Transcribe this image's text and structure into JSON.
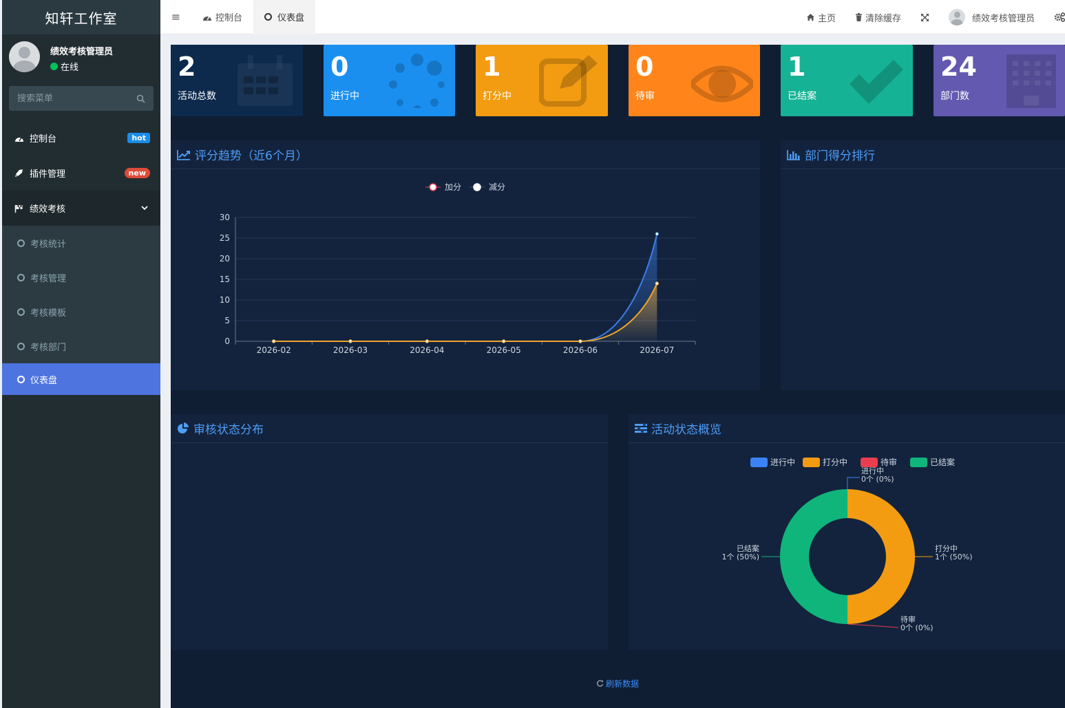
{
  "sidebar": {
    "logo": "知轩工作室",
    "user": {
      "name": "绩效考核管理员",
      "status": "在线"
    },
    "search_placeholder": "搜索菜单",
    "items": [
      {
        "label": "控制台",
        "badge": "hot",
        "icon": "dashboard-icon"
      },
      {
        "label": "插件管理",
        "badge": "new",
        "icon": "rocket-icon"
      },
      {
        "label": "绩效考核",
        "icon": "flag-icon"
      }
    ],
    "subitems": [
      "考核统计",
      "考核管理",
      "考核模板",
      "考核部门",
      "仪表盘"
    ]
  },
  "header": {
    "tabs": [
      "控制台",
      "仪表盘"
    ],
    "home": "主页",
    "clear_cache": "清除缓存",
    "user": "绩效考核管理员"
  },
  "stats": [
    {
      "value": "2",
      "label": "活动总数",
      "color": "#0d2a4c",
      "icon": "calendar-icon"
    },
    {
      "value": "0",
      "label": "进行中",
      "color": "#1a8ff0",
      "icon": "spinner-icon"
    },
    {
      "value": "1",
      "label": "打分中",
      "color": "#f39c12",
      "icon": "edit-icon"
    },
    {
      "value": "0",
      "label": "待审",
      "color": "#ff851b",
      "icon": "eye-icon"
    },
    {
      "value": "1",
      "label": "已结案",
      "color": "#16b295",
      "icon": "check-icon"
    },
    {
      "value": "24",
      "label": "部门数",
      "color": "#6359b0",
      "icon": "building-icon"
    }
  ],
  "panels": {
    "trend": "评分趋势（近6个月）",
    "dept": "部门得分排行",
    "review": "审核状态分布",
    "activity": "活动状态概览"
  },
  "refresh": "刷新数据",
  "chart_data": [
    {
      "type": "line",
      "title": "评分趋势（近6个月）",
      "categories": [
        "2026-02",
        "2026-03",
        "2026-04",
        "2026-05",
        "2026-06",
        "2026-07"
      ],
      "ylim": [
        0,
        30
      ],
      "yticks": [
        0,
        5,
        10,
        15,
        20,
        25,
        30
      ],
      "legend_position": "top",
      "series": [
        {
          "name": "加分",
          "values": [
            0,
            0,
            0,
            0,
            0,
            26
          ],
          "color": "#3d7ee6"
        },
        {
          "name": "减分",
          "values": [
            0,
            0,
            0,
            0,
            0,
            14
          ],
          "color": "#f0a52c"
        }
      ]
    },
    {
      "type": "pie",
      "title": "活动状态概览",
      "legend_position": "top",
      "slices": [
        {
          "name": "进行中",
          "value": 0,
          "label": "0个 (0%)",
          "color": "#3b82f6"
        },
        {
          "name": "打分中",
          "value": 1,
          "label": "1个 (50%)",
          "color": "#f39c12"
        },
        {
          "name": "待审",
          "value": 0,
          "label": "0个 (0%)",
          "color": "#ea3d4e"
        },
        {
          "name": "已结案",
          "value": 1,
          "label": "1个 (50%)",
          "color": "#10b57c"
        }
      ]
    }
  ]
}
